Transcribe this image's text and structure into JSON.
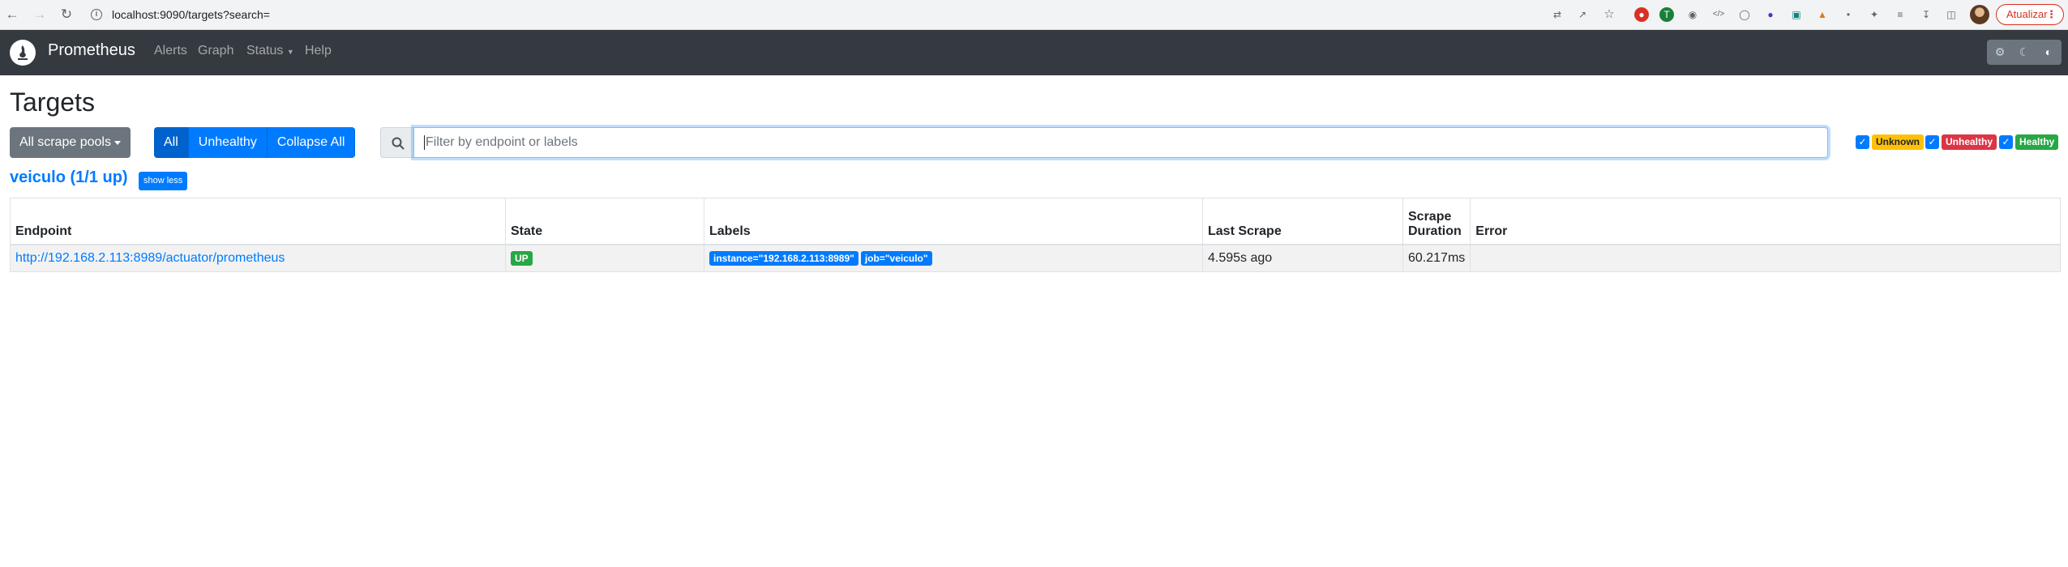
{
  "browser": {
    "url": "localhost:9090/targets?search=",
    "update_label": "Atualizar"
  },
  "navbar": {
    "brand": "Prometheus",
    "links": [
      "Alerts",
      "Graph",
      "Status",
      "Help"
    ]
  },
  "page": {
    "title": "Targets",
    "scrape_pools_button": "All scrape pools",
    "filters": [
      "All",
      "Unhealthy",
      "Collapse All"
    ],
    "search_placeholder": "Filter by endpoint or labels",
    "health_filters": [
      {
        "label": "Unknown",
        "checked": true,
        "color": "#ffc107"
      },
      {
        "label": "Unhealthy",
        "checked": true,
        "color": "#dc3545"
      },
      {
        "label": "Healthy",
        "checked": true,
        "color": "#28a745"
      }
    ]
  },
  "pool": {
    "title": "veiculo (1/1 up)",
    "toggle_label": "show less",
    "columns": [
      "Endpoint",
      "State",
      "Labels",
      "Last Scrape",
      "Scrape Duration",
      "Error"
    ],
    "rows": [
      {
        "endpoint": "http://192.168.2.113:8989/actuator/prometheus",
        "state": "UP",
        "labels": [
          "instance=\"192.168.2.113:8989\"",
          "job=\"veiculo\""
        ],
        "last_scrape": "4.595s ago",
        "scrape_duration": "60.217ms",
        "error": ""
      }
    ]
  }
}
